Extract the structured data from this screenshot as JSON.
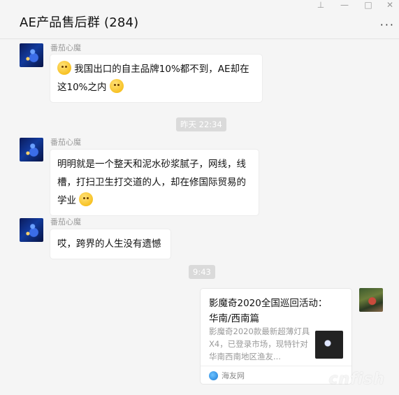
{
  "header": {
    "title": "AE产品售后群 (284)",
    "win_controls": {
      "pin": "⊥",
      "minimize": "—",
      "maximize": "□",
      "close": "✕"
    },
    "more": "···"
  },
  "messages": [
    {
      "sender": "番茄心魔",
      "text_before": "我国出口的自主品牌10%都不到，AE却在",
      "text_after": "这10%之内"
    },
    {
      "time": "昨天 22:34"
    },
    {
      "sender": "番茄心魔",
      "line1": "明明就是一个整天和泥水砂浆腻子，网线，线",
      "line2": "槽，打扫卫生打交道的人，却在修国际贸易的",
      "line3": "学业"
    },
    {
      "sender": "番茄心魔",
      "text": "哎，跨界的人生没有遗憾"
    },
    {
      "time": "9:43"
    }
  ],
  "card": {
    "title": "影魔奇2020全国巡回活动：华南/西南篇",
    "desc": "影魔奇2020款最新超薄灯具X4，已登录市场，现特针对华南西南地区渔友...",
    "source": "海友网"
  },
  "watermark": "cnfish"
}
